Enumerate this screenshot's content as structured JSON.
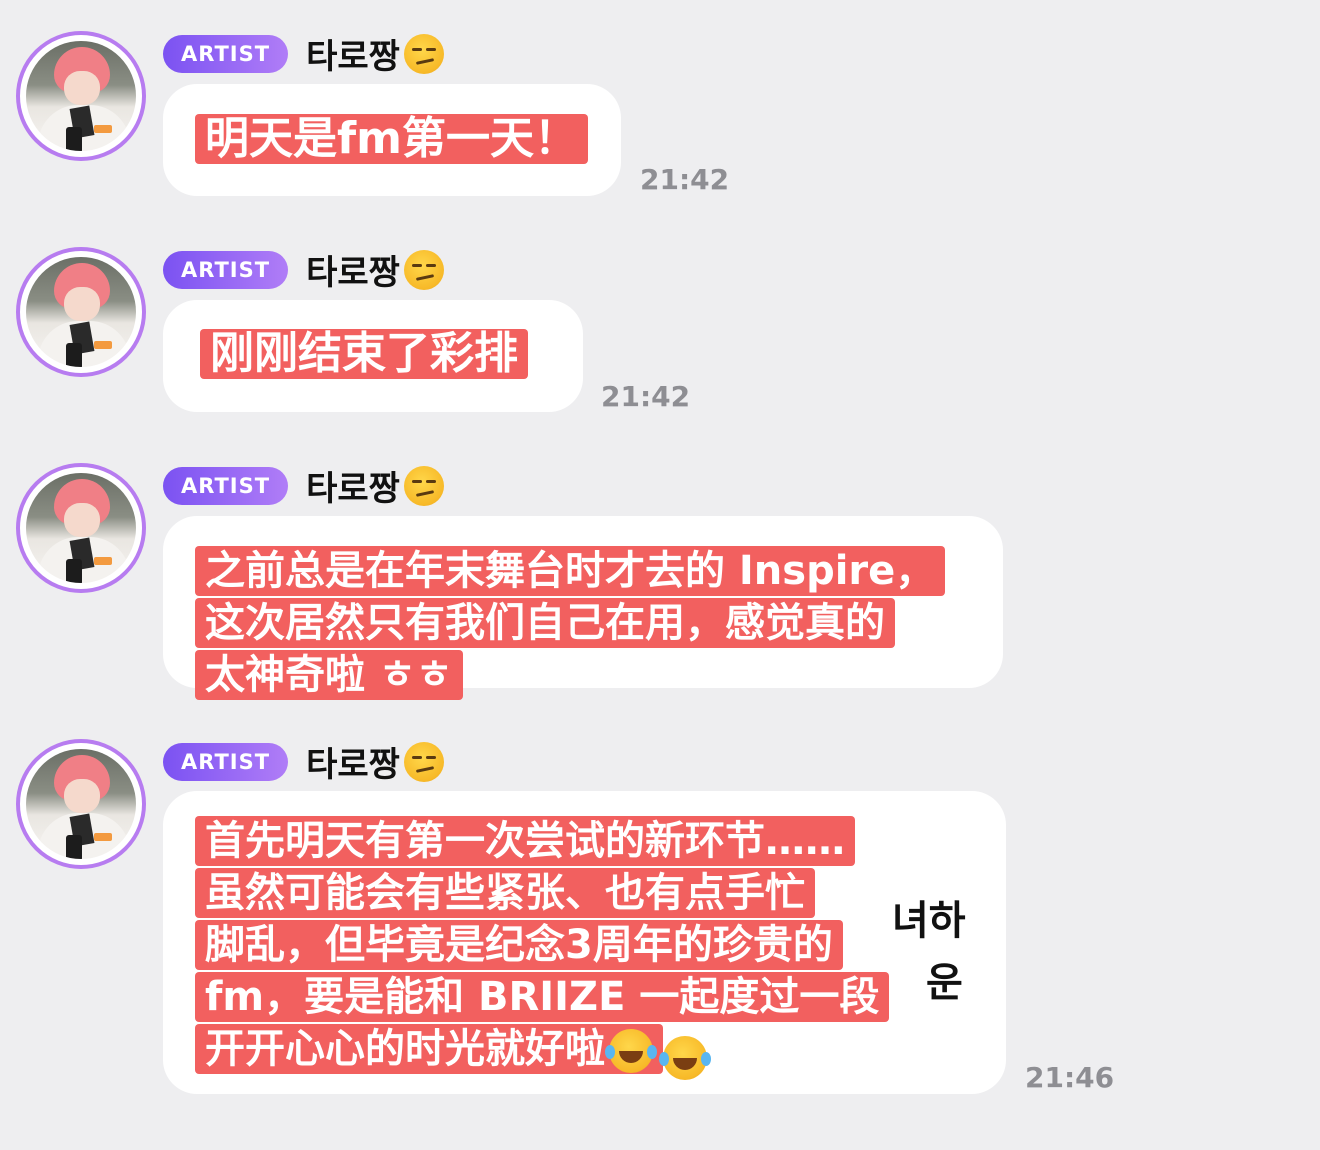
{
  "messages": [
    {
      "badge": "ARTIST",
      "name": "타로짱",
      "lines": [
        "明天是fm第一天！"
      ],
      "time": "21:42"
    },
    {
      "badge": "ARTIST",
      "name": "타로짱",
      "lines": [
        "刚刚结束了彩排"
      ],
      "time": "21:42"
    },
    {
      "badge": "ARTIST",
      "name": "타로짱",
      "lines": [
        "之前总是在年末舞台时才去的 Inspire，",
        "这次居然只有我们自己在用，感觉真的",
        "太神奇啦 ㅎㅎ"
      ],
      "time": ""
    },
    {
      "badge": "ARTIST",
      "name": "타로짱",
      "lines": [
        "首先明天有第一次尝试的新环节……",
        "虽然可能会有些紧张、也有点手忙",
        "脚乱，但毕竟是纪念3周年的珍贵的",
        "fm，要是能和 BRIIZE 一起度过一段",
        "开开心心的时光就好啦"
      ],
      "time": "21:46",
      "peek_text": [
        "녀하",
        "운"
      ]
    }
  ],
  "icons": {
    "name_emoji": "smirking-face-icon",
    "end_emoji": "laughing-tears-icon"
  },
  "colors": {
    "badge_start": "#7b52f2",
    "badge_end": "#b07df7",
    "highlight": "#f2605f",
    "avatar_ring": "#b77cf0",
    "background": "#eeeef0"
  }
}
